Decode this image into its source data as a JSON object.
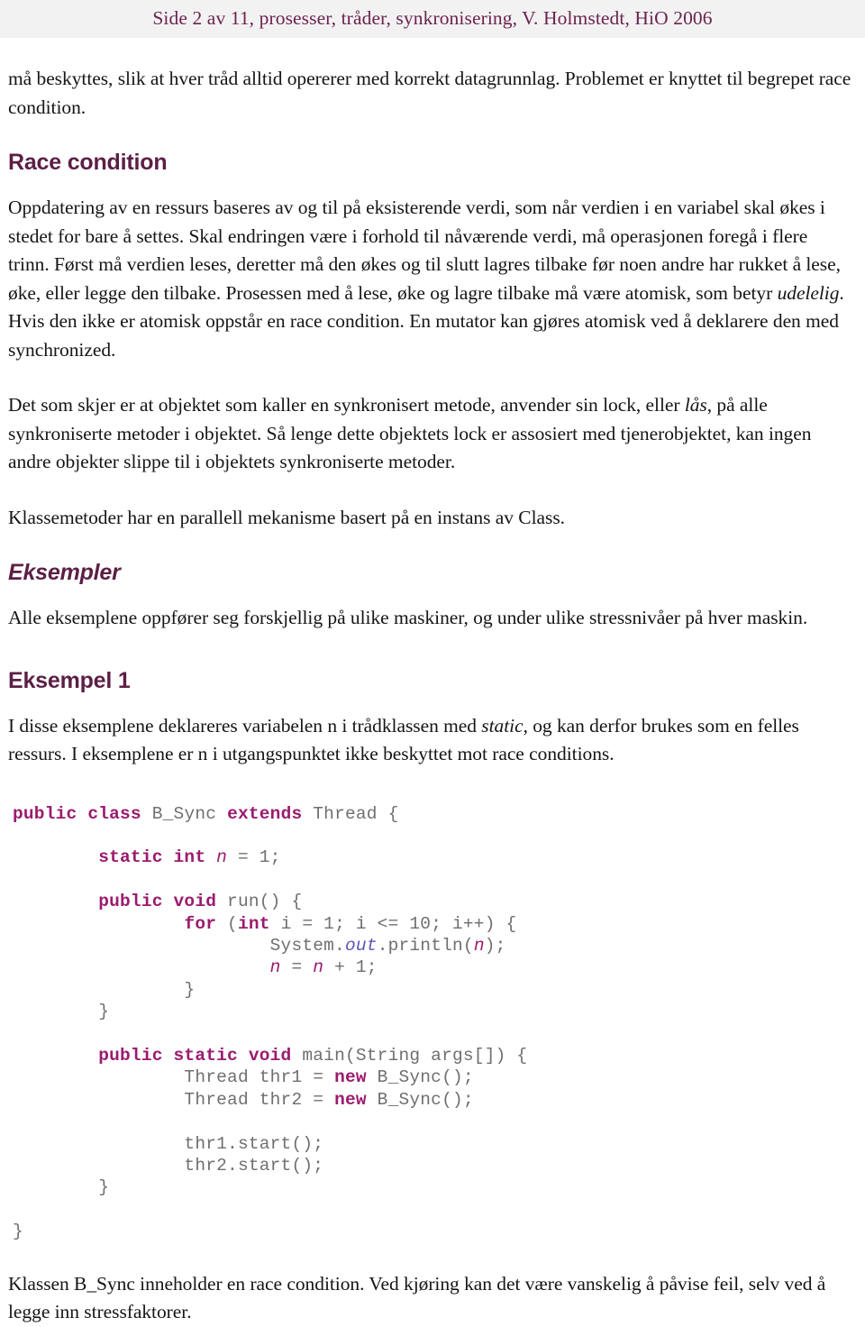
{
  "header": {
    "text": "Side 2 av 11, prosesser, tråder, synkronisering, V. Holmstedt, HiO 2006",
    "background": "#f2f2f2",
    "text_color": "#6b2350"
  },
  "document": {
    "intro_paragraph": "må beskyttes, slik at hver tråd alltid opererer med korrekt datagrunnlag. Problemet er knyttet til begrepet race condition.",
    "sections": [
      {
        "heading": "Race condition",
        "heading_style": "bold",
        "paragraphs": [
          {
            "parts": [
              {
                "text": "Oppdatering av en ressurs baseres av og til på eksisterende verdi, som når verdien i en variabel skal økes i stedet for bare å settes. Skal endringen være i forhold til nåværende verdi, må operasjonen foregå i flere trinn. Først må verdien leses, deretter må den økes og til slutt lagres tilbake før noen andre har rukket å lese, øke, eller legge den tilbake. Prosessen med å lese, øke og lagre tilbake må være atomisk, som betyr ",
                "style": "normal"
              },
              {
                "text": "udelelig",
                "style": "italic"
              },
              {
                "text": ". Hvis den ikke er atomisk oppstår en race condition. En mutator kan gjøres atomisk ved å deklarere den med synchronized.",
                "style": "normal"
              }
            ]
          },
          {
            "parts": [
              {
                "text": "Det som skjer er at objektet som kaller en synkronisert metode, anvender sin lock, eller ",
                "style": "normal"
              },
              {
                "text": "lås",
                "style": "italic"
              },
              {
                "text": ", på alle synkroniserte metoder i objektet. Så lenge dette objektets lock er assosiert med tjenerobjektet, kan ingen andre objekter slippe til i objektets synkroniserte metoder.",
                "style": "normal"
              }
            ]
          },
          {
            "parts": [
              {
                "text": "Klassemetoder har en parallell mekanisme basert på en instans av Class.",
                "style": "normal"
              }
            ]
          }
        ]
      },
      {
        "heading": "Eksempler",
        "heading_style": "bold-italic",
        "paragraphs": [
          {
            "parts": [
              {
                "text": "Alle eksemplene oppfører seg forskjellig på ulike maskiner, og under ulike stressnivåer på hver maskin.",
                "style": "normal"
              }
            ]
          }
        ]
      },
      {
        "heading": "Eksempel 1",
        "heading_style": "bold",
        "paragraphs": [
          {
            "parts": [
              {
                "text": "I disse eksemplene deklareres variabelen n i trådklassen med ",
                "style": "normal"
              },
              {
                "text": "static",
                "style": "italic"
              },
              {
                "text": ", og kan derfor brukes som en felles ressurs. I eksemplene er n i utgangspunktet ikke beskyttet mot race conditions.",
                "style": "normal"
              }
            ]
          }
        ]
      }
    ],
    "closing_paragraph": "Klassen B_Sync inneholder en race condition. Ved kjøring kan det være vanskelig å påvise feil, selv ved å legge inn stressfaktorer."
  },
  "code": {
    "language": "java",
    "class_name": "B_Sync",
    "colors": {
      "keyword": "#9b1b6e",
      "plain": "#6f6f6f",
      "field": "#9b1b6e",
      "static_field": "#5a56b8"
    },
    "lines": [
      [
        {
          "t": "public class ",
          "c": "kw"
        },
        {
          "t": "B_Sync ",
          "c": "pln"
        },
        {
          "t": "extends ",
          "c": "kw"
        },
        {
          "t": "Thread {",
          "c": "pln"
        }
      ],
      [],
      [
        {
          "t": "        ",
          "c": "pln"
        },
        {
          "t": "static int ",
          "c": "kw"
        },
        {
          "t": "n",
          "c": "fld"
        },
        {
          "t": " = 1;",
          "c": "pln"
        }
      ],
      [],
      [
        {
          "t": "        ",
          "c": "pln"
        },
        {
          "t": "public void ",
          "c": "kw"
        },
        {
          "t": "run() {",
          "c": "pln"
        }
      ],
      [
        {
          "t": "                ",
          "c": "pln"
        },
        {
          "t": "for ",
          "c": "kw"
        },
        {
          "t": "(",
          "c": "pln"
        },
        {
          "t": "int ",
          "c": "kw"
        },
        {
          "t": "i = 1; i <= 10; i++) {",
          "c": "pln"
        }
      ],
      [
        {
          "t": "                        System.",
          "c": "pln"
        },
        {
          "t": "out",
          "c": "sfld"
        },
        {
          "t": ".println(",
          "c": "pln"
        },
        {
          "t": "n",
          "c": "fld"
        },
        {
          "t": ");",
          "c": "pln"
        }
      ],
      [
        {
          "t": "                        ",
          "c": "pln"
        },
        {
          "t": "n",
          "c": "fld"
        },
        {
          "t": " = ",
          "c": "pln"
        },
        {
          "t": "n",
          "c": "fld"
        },
        {
          "t": " + 1;",
          "c": "pln"
        }
      ],
      [
        {
          "t": "                }",
          "c": "pln"
        }
      ],
      [
        {
          "t": "        }",
          "c": "pln"
        }
      ],
      [],
      [
        {
          "t": "        ",
          "c": "pln"
        },
        {
          "t": "public static void ",
          "c": "kw"
        },
        {
          "t": "main(String args[]) {",
          "c": "pln"
        }
      ],
      [
        {
          "t": "                Thread thr1 = ",
          "c": "pln"
        },
        {
          "t": "new ",
          "c": "kw"
        },
        {
          "t": "B_Sync();",
          "c": "pln"
        }
      ],
      [
        {
          "t": "                Thread thr2 = ",
          "c": "pln"
        },
        {
          "t": "new ",
          "c": "kw"
        },
        {
          "t": "B_Sync();",
          "c": "pln"
        }
      ],
      [],
      [
        {
          "t": "                thr1.start();",
          "c": "pln"
        }
      ],
      [
        {
          "t": "                thr2.start();",
          "c": "pln"
        }
      ],
      [
        {
          "t": "        }",
          "c": "pln"
        }
      ],
      [],
      [
        {
          "t": "}",
          "c": "pln"
        }
      ]
    ]
  }
}
